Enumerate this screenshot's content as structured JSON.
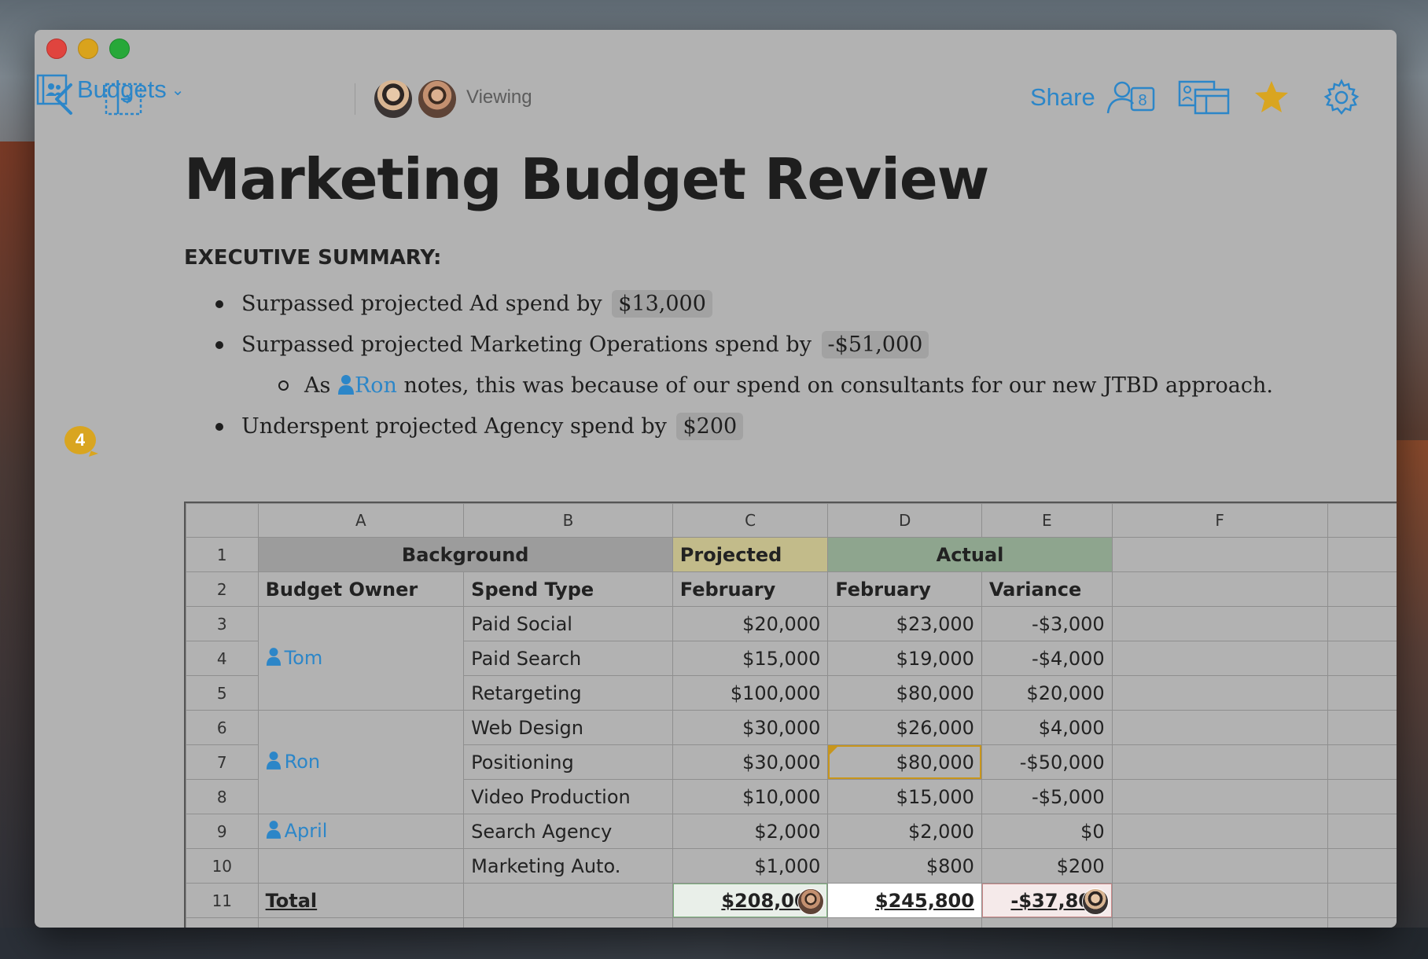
{
  "toolbar": {
    "folder_label": "Budgets",
    "viewing_label": "Viewing",
    "share_label": "Share",
    "share_count": "8",
    "accent_color": "#2c86c8",
    "star_color": "#d9a520"
  },
  "document": {
    "title": "Marketing Budget Review",
    "exec_summary": "EXECUTIVE SUMMARY:",
    "bullets": [
      {
        "text": "Surpassed projected Ad spend by",
        "value": "$13,000"
      },
      {
        "text": "Surpassed projected Marketing Operations spend by",
        "value": "-$51,000"
      },
      {
        "prefix": "As",
        "mention": "Ron",
        "text": "notes, this was because of our spend on consultants for our new JTBD approach."
      },
      {
        "text": "Underspent projected Agency spend by",
        "value": "$200"
      }
    ],
    "comment_count": "4"
  },
  "sheet": {
    "columns": [
      "A",
      "B",
      "C",
      "D",
      "E",
      "F"
    ],
    "row_numbers": [
      "1",
      "2",
      "3",
      "4",
      "5",
      "6",
      "7",
      "8",
      "9",
      "10",
      "11"
    ],
    "group_headers": {
      "background": "Background",
      "projected": "Projected",
      "actual": "Actual"
    },
    "headers": [
      "Budget Owner",
      "Spend Type",
      "February",
      "February",
      "Variance"
    ],
    "owners": [
      "Tom",
      "Ron",
      "April"
    ],
    "rows": [
      {
        "spend_type": "Paid Social",
        "projected": "$20,000",
        "actual": "$23,000",
        "variance": "-$3,000"
      },
      {
        "spend_type": "Paid Search",
        "projected": "$15,000",
        "actual": "$19,000",
        "variance": "-$4,000"
      },
      {
        "spend_type": "Retargeting",
        "projected": "$100,000",
        "actual": "$80,000",
        "variance": "$20,000"
      },
      {
        "spend_type": "Web Design",
        "projected": "$30,000",
        "actual": "$26,000",
        "variance": "$4,000"
      },
      {
        "spend_type": "Positioning",
        "projected": "$30,000",
        "actual": "$80,000",
        "variance": "-$50,000"
      },
      {
        "spend_type": "Video Production",
        "projected": "$10,000",
        "actual": "$15,000",
        "variance": "-$5,000"
      },
      {
        "spend_type": "Search Agency",
        "projected": "$2,000",
        "actual": "$2,000",
        "variance": "$0"
      },
      {
        "spend_type": "Marketing Auto.",
        "projected": "$1,000",
        "actual": "$800",
        "variance": "$200"
      }
    ],
    "total": {
      "label": "Total",
      "projected": "$208,000",
      "actual": "$245,800",
      "variance": "-$37,800"
    }
  }
}
